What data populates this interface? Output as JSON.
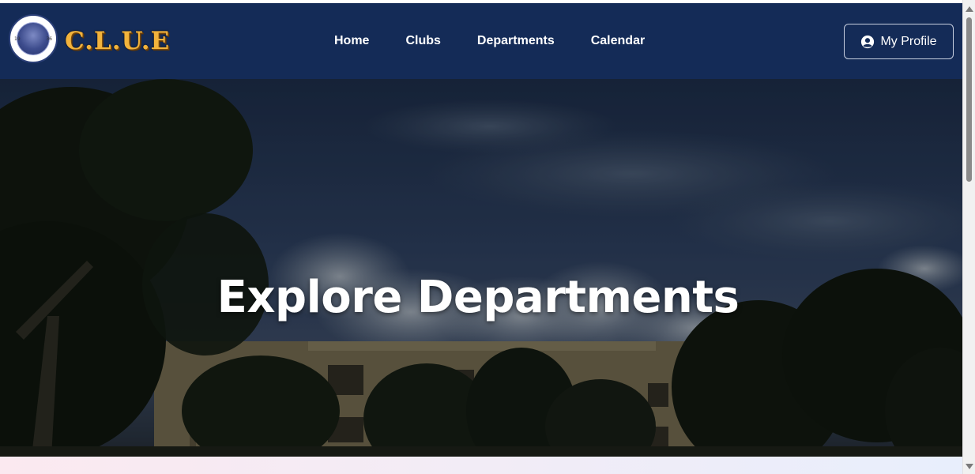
{
  "brand": {
    "name": "C.L.U.E",
    "seal_text_left": "19",
    "seal_text_right": "36"
  },
  "nav": {
    "links": [
      {
        "label": "Home"
      },
      {
        "label": "Clubs"
      },
      {
        "label": "Departments"
      },
      {
        "label": "Calendar"
      }
    ]
  },
  "profile": {
    "label": "My Profile",
    "icon": "user-circle-icon"
  },
  "hero": {
    "title": "Explore Departments"
  },
  "colors": {
    "navbar_bg": "#142b57",
    "brand_gold": "#f2b33c",
    "text_white": "#ffffff"
  }
}
